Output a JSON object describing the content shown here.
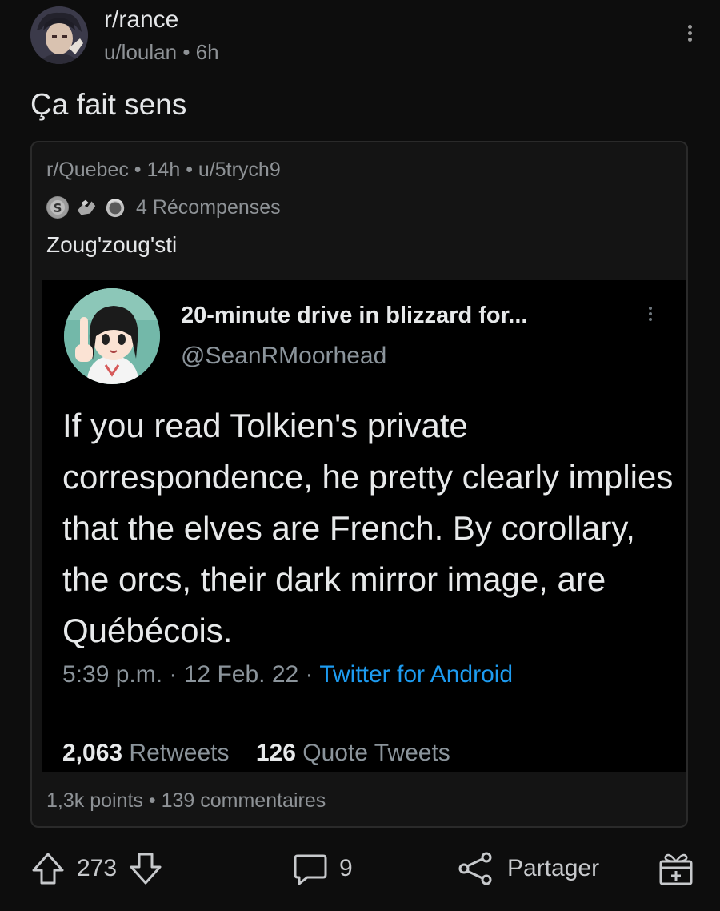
{
  "post": {
    "subreddit": "r/rance",
    "author": "u/loulan",
    "age": "6h",
    "meta_separator": "•",
    "title": "Ça fait sens"
  },
  "crosspost": {
    "subreddit": "r/Quebec",
    "age": "14h",
    "author": "u/5trych9",
    "awards_label": "4 Récompenses",
    "award_icons": [
      "silver-award-icon",
      "wholesome-award-icon",
      "helpful-award-icon"
    ],
    "title": "Zoug'zoug'sti",
    "points": "1,3k points",
    "comments": "139 commentaires"
  },
  "tweet": {
    "display_name": "20-minute drive in blizzard for...",
    "handle": "@SeanRMoorhead",
    "text": "If you read Tolkien's private correspondence, he pretty clearly implies that the elves are French. By corollary, the orcs, their dark mirror image, are Québécois.",
    "time": "5:39 p.m.",
    "date": "12 Feb. 22",
    "source": "Twitter for Android",
    "retweets_count": "2,063",
    "retweets_label": "Retweets",
    "quotes_count": "126",
    "quotes_label": "Quote Tweets"
  },
  "actions": {
    "vote_count": "273",
    "comment_count": "9",
    "share_label": "Partager"
  },
  "colors": {
    "background": "#0d0d0d",
    "card_background": "#141414",
    "tweet_background": "#000000",
    "link_blue": "#1d9bf0"
  }
}
